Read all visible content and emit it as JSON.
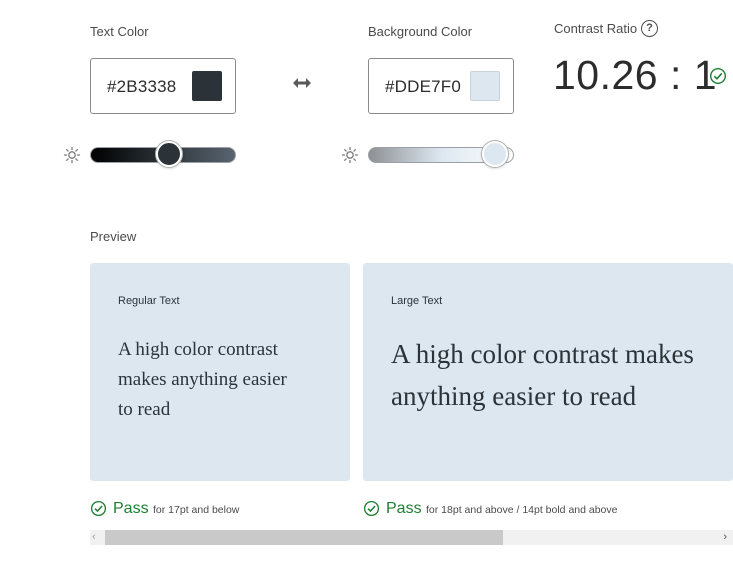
{
  "text_color": {
    "label": "Text Color",
    "hex": "#2B3338",
    "swatch_color": "#2B3338",
    "slider_gradient": [
      "#000000",
      "#2B3338",
      "#5a6470"
    ],
    "slider_level": 0.54
  },
  "swap_icon": "swap-horizontal-icon",
  "background_color": {
    "label": "Background Color",
    "hex": "#DDE7F0",
    "swatch_color": "#DDE7F0",
    "slider_gradient": [
      "#8e9194",
      "#DDE7F0",
      "#ffffff"
    ],
    "slider_level": 0.87
  },
  "contrast": {
    "label": "Contrast Ratio",
    "help_icon": "?",
    "value": "10.26 : 1",
    "status_icon": "check-circle-icon"
  },
  "preview": {
    "label": "Preview",
    "regular": {
      "title": "Regular Text",
      "line1": "A high color contrast",
      "line2": "makes anything easier",
      "line3": "to read",
      "pass_label": "Pass",
      "pass_note": "for 17pt and below"
    },
    "large": {
      "title": "Large Text",
      "line1": "A high color contrast makes",
      "line2": "anything easier to read",
      "pass_label": "Pass",
      "pass_note": "for 18pt and above / 14pt bold and above"
    }
  },
  "scrollbar": {
    "left_arrow": "‹",
    "right_arrow": "›"
  },
  "colors": {
    "pass_green": "#1E7F33",
    "card_background": "#DDE7F0",
    "card_text": "#2B3338"
  }
}
